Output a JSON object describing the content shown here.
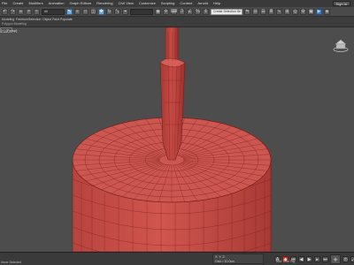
{
  "menubar": {
    "items": [
      "File",
      "Create",
      "Modifiers",
      "Animation",
      "Graph Editors",
      "Rendering",
      "Civil View",
      "Customize",
      "Scripting",
      "Content",
      "Arnold",
      "Help"
    ],
    "sign_in": "Sign In",
    "close": "×"
  },
  "toolbar": {
    "selection_filter": "All",
    "named_selection": "Create Selection Se"
  },
  "ribbon": {
    "row1": [
      "Modeling",
      "Freeform",
      "Selection",
      "Object Paint",
      "Populate"
    ],
    "row2": [
      "Polygon Modeling"
    ]
  },
  "viewport": {
    "label": "[+] [Persp]"
  },
  "status": {
    "left": "None Selected",
    "coord_x": "X:",
    "coord_y": "Y:",
    "coord_z": "Z:",
    "grid": "Grid = 10.0cm",
    "time_tag": "Add Time Tag"
  },
  "colors": {
    "object_fill": "#c9524c",
    "wire": "#7a1e1a",
    "viewport_bg": "#4d4d4d",
    "toolbar_active": "#6fa6d6"
  }
}
